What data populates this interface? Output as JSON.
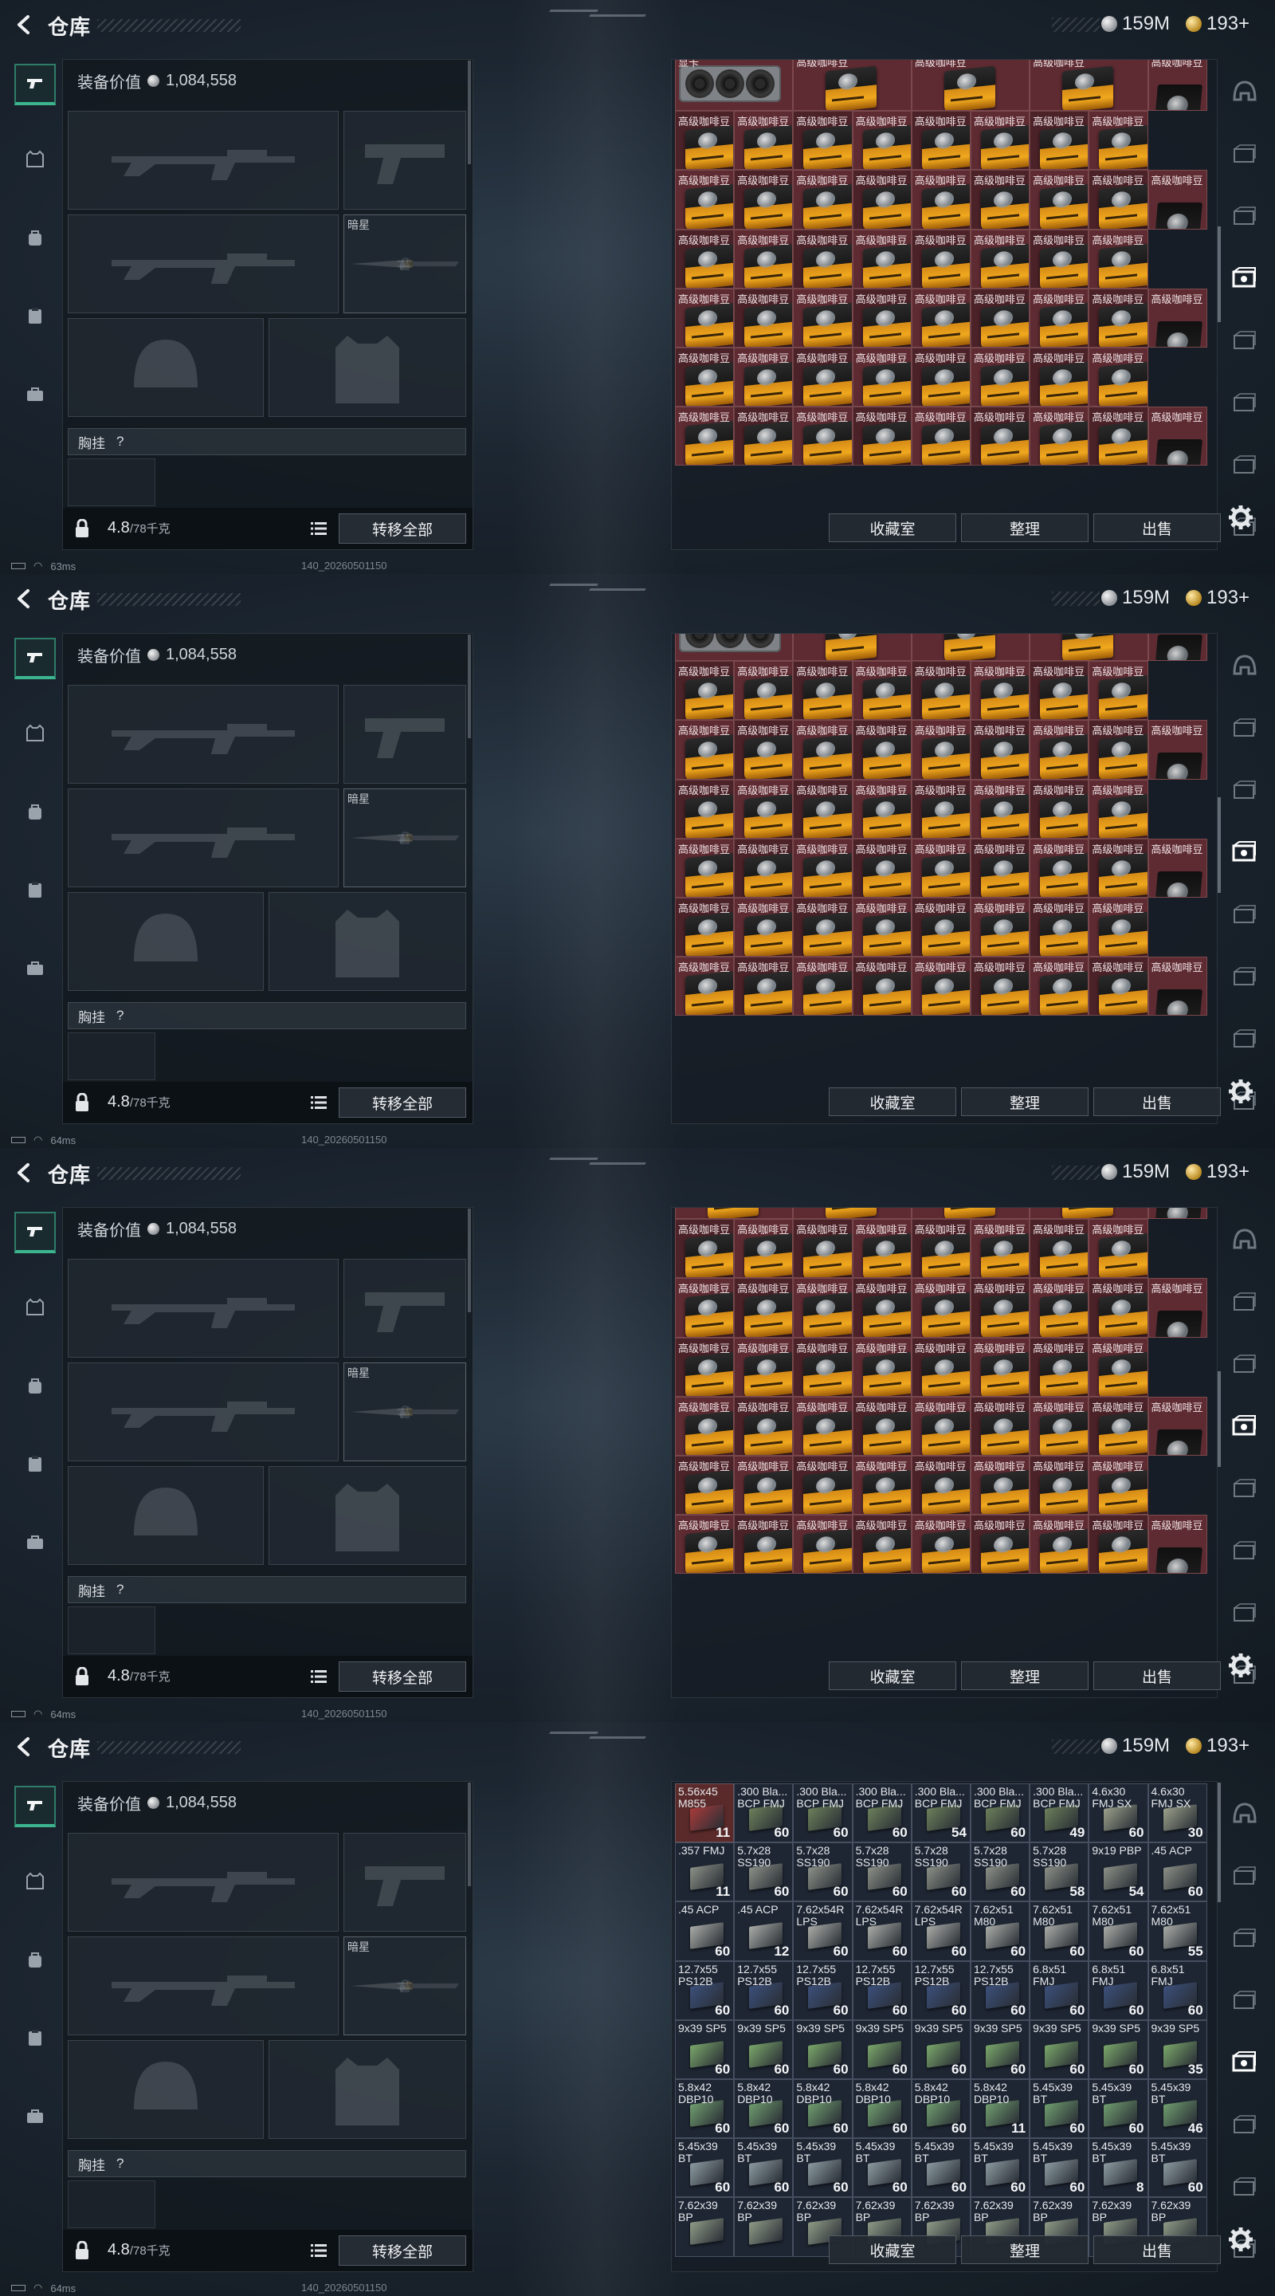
{
  "header": {
    "title": "仓库",
    "silver": "159M",
    "gold": "193+"
  },
  "left_panel": {
    "equip_value_label": "装备价值",
    "equip_value": "1,084,558",
    "melee_slot_name": "暗星",
    "chest_rig_label": "胸挂",
    "chest_rig_help": "?",
    "weight": "4.8",
    "weight_max": "/78千克",
    "transfer_all": "转移全部"
  },
  "right_panel": {
    "buttons": {
      "favorites": "收藏室",
      "sort": "整理",
      "sell": "出售"
    },
    "coffee_label": "高级咖啡豆",
    "gpu_label": "显卡"
  },
  "status": {
    "ping_label": "ms",
    "pings": [
      "63ms",
      "64ms",
      "64ms",
      "64ms"
    ],
    "build": "140_20260501150"
  },
  "colors": {
    "accent": "#3cb58f",
    "storage_cell": "#5e2b32",
    "ammo_cell": "#1e2633"
  },
  "ammo_grid": [
    [
      "5.56x45 M855",
      "11"
    ],
    [
      ".300 Bla... BCP FMJ",
      "60"
    ],
    [
      ".300 Bla... BCP FMJ",
      "60"
    ],
    [
      ".300 Bla... BCP FMJ",
      "60"
    ],
    [
      ".300 Bla... BCP FMJ",
      "54"
    ],
    [
      ".300 Bla... BCP FMJ",
      "60"
    ],
    [
      ".300 Bla... BCP FMJ",
      "49"
    ],
    [
      "4.6x30 FMJ SX",
      "60"
    ],
    [
      "4.6x30 FMJ SX",
      "30"
    ],
    [
      ".357 FMJ",
      "11"
    ],
    [
      "5.7x28 SS190",
      "60"
    ],
    [
      "5.7x28 SS190",
      "60"
    ],
    [
      "5.7x28 SS190",
      "60"
    ],
    [
      "5.7x28 SS190",
      "60"
    ],
    [
      "5.7x28 SS190",
      "60"
    ],
    [
      "5.7x28 SS190",
      "58"
    ],
    [
      "9x19 PBP",
      "54"
    ],
    [
      ".45 ACP",
      "60"
    ],
    [
      ".45 ACP",
      "60"
    ],
    [
      ".45 ACP",
      "12"
    ],
    [
      "7.62x54R LPS",
      "60"
    ],
    [
      "7.62x54R LPS",
      "60"
    ],
    [
      "7.62x54R LPS",
      "60"
    ],
    [
      "7.62x51 M80",
      "60"
    ],
    [
      "7.62x51 M80",
      "60"
    ],
    [
      "7.62x51 M80",
      "60"
    ],
    [
      "7.62x51 M80",
      "55"
    ],
    [
      "12.7x55 PS12B",
      "60"
    ],
    [
      "12.7x55 PS12B",
      "60"
    ],
    [
      "12.7x55 PS12B",
      "60"
    ],
    [
      "12.7x55 PS12B",
      "60"
    ],
    [
      "12.7x55 PS12B",
      "60"
    ],
    [
      "12.7x55 PS12B",
      "60"
    ],
    [
      "6.8x51 FMJ",
      "60"
    ],
    [
      "6.8x51 FMJ",
      "60"
    ],
    [
      "6.8x51 FMJ",
      "60"
    ],
    [
      "9x39 SP5",
      "60"
    ],
    [
      "9x39 SP5",
      "60"
    ],
    [
      "9x39 SP5",
      "60"
    ],
    [
      "9x39 SP5",
      "60"
    ],
    [
      "9x39 SP5",
      "60"
    ],
    [
      "9x39 SP5",
      "60"
    ],
    [
      "9x39 SP5",
      "60"
    ],
    [
      "9x39 SP5",
      "60"
    ],
    [
      "9x39 SP5",
      "35"
    ],
    [
      "5.8x42 DBP10",
      "60"
    ],
    [
      "5.8x42 DBP10",
      "60"
    ],
    [
      "5.8x42 DBP10",
      "60"
    ],
    [
      "5.8x42 DBP10",
      "60"
    ],
    [
      "5.8x42 DBP10",
      "60"
    ],
    [
      "5.8x42 DBP10",
      "11"
    ],
    [
      "5.45x39 BT",
      "60"
    ],
    [
      "5.45x39 BT",
      "60"
    ],
    [
      "5.45x39 BT",
      "46"
    ],
    [
      "5.45x39 BT",
      "60"
    ],
    [
      "5.45x39 BT",
      "60"
    ],
    [
      "5.45x39 BT",
      "60"
    ],
    [
      "5.45x39 BT",
      "60"
    ],
    [
      "5.45x39 BT",
      "60"
    ],
    [
      "5.45x39 BT",
      "60"
    ],
    [
      "5.45x39 BT",
      "60"
    ],
    [
      "5.45x39 BT",
      "8"
    ],
    [
      "5.45x39 BT",
      "60"
    ],
    [
      "7.62x39 BP",
      ""
    ],
    [
      "7.62x39 BP",
      ""
    ],
    [
      "7.62x39 BP",
      ""
    ],
    [
      "7.62x39 BP",
      ""
    ],
    [
      "7.62x39 BP",
      ""
    ],
    [
      "7.62x39 BP",
      ""
    ],
    [
      "7.62x39 BP",
      ""
    ],
    [
      "7.62x39 BP",
      ""
    ],
    [
      "7.62x39 BP",
      ""
    ]
  ]
}
